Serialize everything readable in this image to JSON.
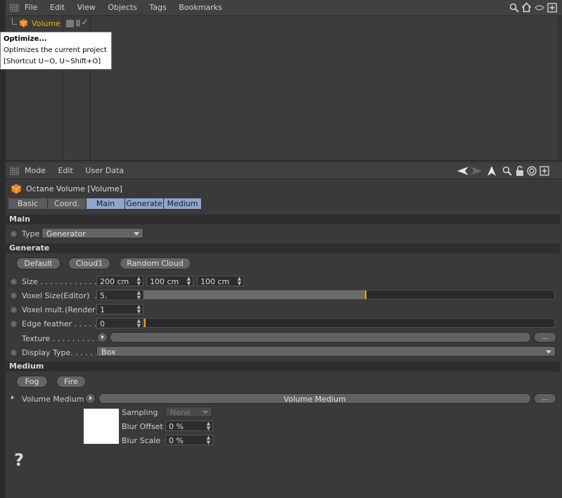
{
  "top_menu": [
    "File",
    "Edit",
    "View",
    "Objects",
    "Tags",
    "Bookmarks"
  ],
  "object": {
    "name": "Volume",
    "check": "✓"
  },
  "tooltip": {
    "title": "Optimize...",
    "description": "Optimizes the current project",
    "shortcut": "[Shortcut U~O, U~Shift+O]"
  },
  "attr_menu": [
    "Mode",
    "Edit",
    "User Data"
  ],
  "attr_title": "Octane Volume [Volume]",
  "tabs": [
    "Basic",
    "Coord.",
    "Main",
    "Generate",
    "Medium"
  ],
  "active_tabs": [
    "Main",
    "Generate",
    "Medium"
  ],
  "sections": {
    "main": "Main",
    "generate": "Generate",
    "medium": "Medium"
  },
  "type_field": {
    "label": "Type",
    "value": "Generator"
  },
  "generate_buttons": [
    "Default",
    "Cloud1",
    "Random Cloud"
  ],
  "size": {
    "label": "Size . . . . . . . . . . . . .",
    "values": [
      "200 cm",
      "100 cm",
      "100 cm"
    ]
  },
  "voxel_size": {
    "label": "Voxel Size(Editor)  .",
    "value": "5.",
    "slider": 0.54
  },
  "voxel_mult": {
    "label": "Voxel mult.(Render)",
    "value": "1"
  },
  "edge_feather": {
    "label": "Edge feather . . . . .",
    "value": "0",
    "slider": 0.0
  },
  "texture": {
    "label": "Texture . . . . . . . . . .",
    "more": "..."
  },
  "display_type": {
    "label": "Display Type. . . . . .",
    "value": "Box"
  },
  "medium_buttons": [
    "Fog",
    "Fire"
  ],
  "volume_medium": {
    "label": "Volume Medium",
    "value": "Volume Medium",
    "more": "..."
  },
  "sampling": {
    "label": "Sampling",
    "value": "None"
  },
  "blur_offset": {
    "label": "Blur Offset",
    "value": "0 %"
  },
  "blur_scale": {
    "label": "Blur Scale",
    "value": "0 %"
  },
  "help": "?"
}
